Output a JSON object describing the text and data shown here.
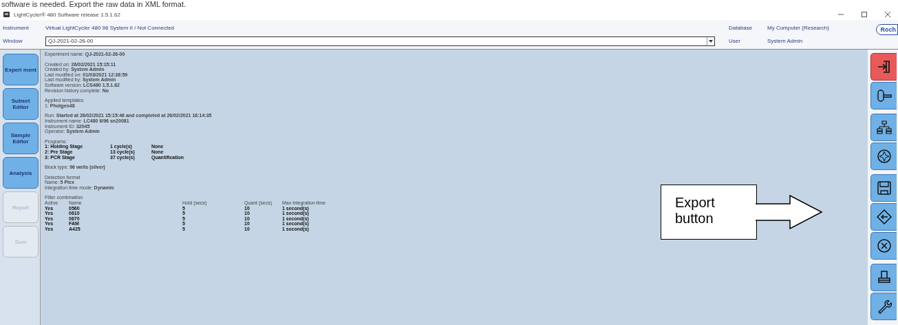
{
  "caption": "software is needed. Export the raw data in XML format.",
  "window": {
    "title": "LightCycler® 480 Software release 1.5.1.62"
  },
  "header": {
    "instrument_label": "Instrument",
    "instrument": "Virtual LightCycler 480 96 System II / Not Connected",
    "window_label": "Window",
    "window_value": "QJ-2021-02-26-00",
    "database_label": "Database",
    "database": "My Computer (Research)",
    "user_label": "User",
    "user": "System Admin",
    "logo": "Roch"
  },
  "nav": [
    {
      "label": "Experi ment",
      "disabled": false
    },
    {
      "label": "Subset Editor",
      "disabled": false
    },
    {
      "label": "Sample Editor",
      "disabled": false
    },
    {
      "label": "Analysis",
      "disabled": false
    },
    {
      "label": "Report",
      "disabled": true
    },
    {
      "label": "Sum",
      "disabled": true
    }
  ],
  "sections": [
    {
      "kind": "lines",
      "lines": [
        "Experiment name: **QJ-2021-02-26-00**"
      ]
    },
    {
      "kind": "lines",
      "lines": [
        "Created on: **26/02/2021 15:15:11**",
        "Created by: **System Admin**",
        "Last modified on: **01/03/2021 12:38:59**",
        "Last modified by: **System Admin**",
        "Software version: **LCS480 1.5.1.62**",
        "Revision history complete: **No**"
      ]
    },
    {
      "kind": "lines",
      "lines": [
        "Applied templates:",
        "1: **Photgen48**"
      ]
    },
    {
      "kind": "lines",
      "lines": [
        "Run: **Started at 26/02/2021 15:15:46 and completed at 26/02/2021 16:14:35**",
        "Instrument name: **LC480 II/96 sn20081**",
        "Instrument ID: **32045**",
        "Operator: **System Admin**"
      ]
    },
    {
      "kind": "table",
      "title": "Programs:",
      "rows": [
        [
          "1: **Holding Stage**",
          "1 cycle(s)",
          "None"
        ],
        [
          "2: **Pre Stage**",
          "13 cycle(s)",
          "None"
        ],
        [
          "3: **PCR Stage**",
          "37 cycle(s)",
          "Quantification"
        ]
      ]
    },
    {
      "kind": "lines",
      "lines": [
        "Block type: **96 wells (silver)**"
      ]
    },
    {
      "kind": "lines",
      "lines": [
        "Detection format",
        "Name: **5 Plex**",
        "Integration time mode: **Dynamic**"
      ]
    },
    {
      "kind": "table",
      "title": "Filter combination",
      "columns": [
        "Active",
        "Name",
        "Hold (secs)",
        "Quant (secs)",
        "Max integration time"
      ],
      "rows": [
        [
          "Yes",
          "0560",
          "5",
          "10",
          "1 second(s)"
        ],
        [
          "Yes",
          "0610",
          "5",
          "10",
          "1 second(s)"
        ],
        [
          "Yes",
          "0670",
          "5",
          "10",
          "1 second(s)"
        ],
        [
          "Yes",
          "FAM",
          "5",
          "10",
          "1 second(s)"
        ],
        [
          "Yes",
          "A425",
          "5",
          "10",
          "1 second(s)"
        ]
      ]
    }
  ],
  "callout": {
    "text": "Export button"
  }
}
